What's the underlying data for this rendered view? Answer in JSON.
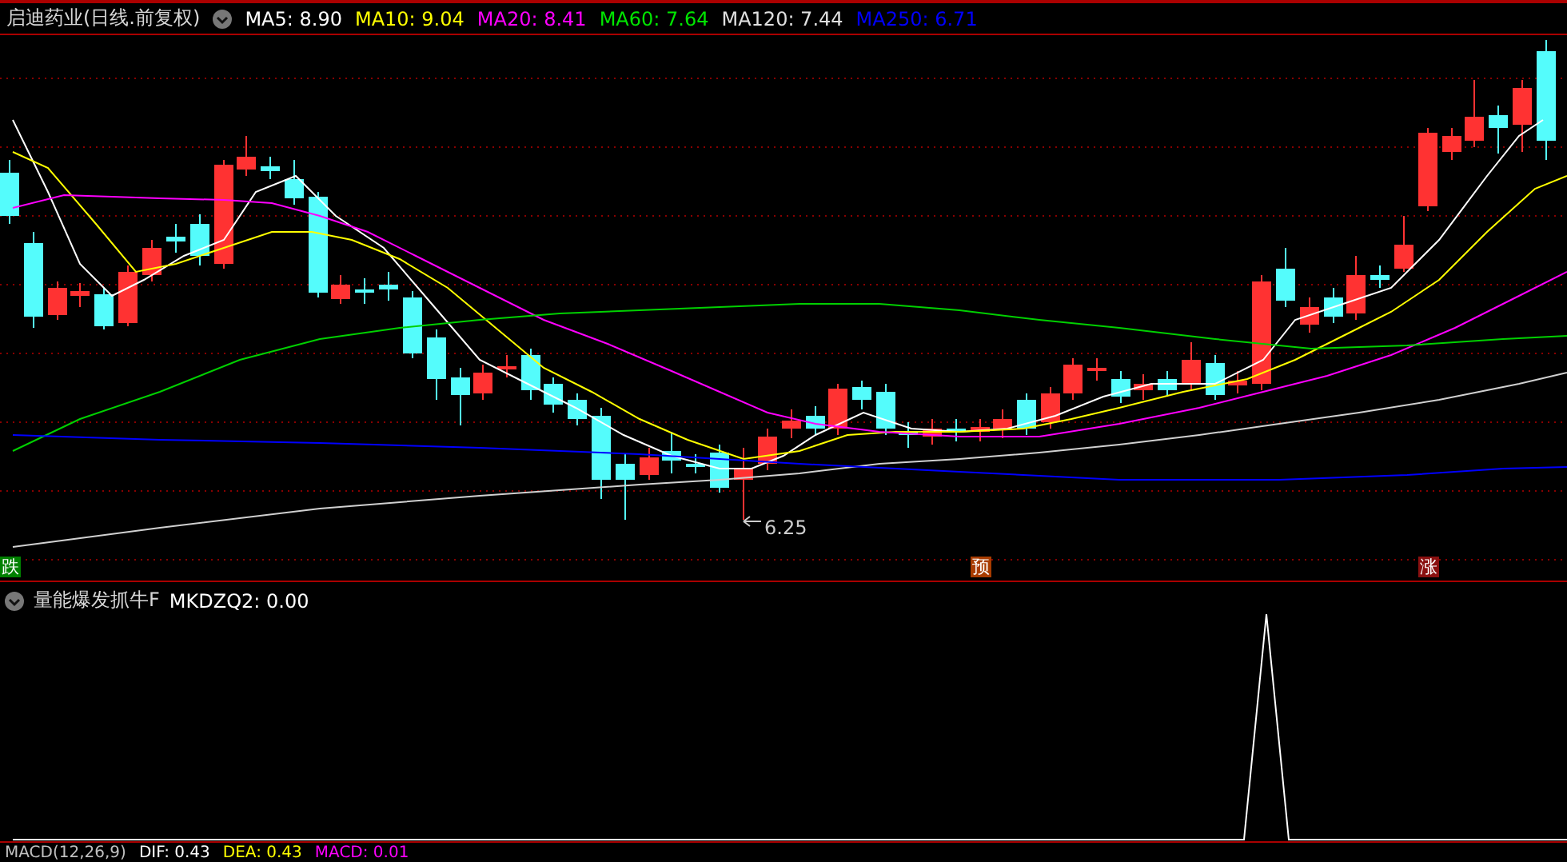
{
  "header": {
    "title": "启迪药业(日线.前复权)",
    "indicators": [
      {
        "label": "MA5: 8.90",
        "color": "#ffffff"
      },
      {
        "label": "MA10: 9.04",
        "color": "#ffff00"
      },
      {
        "label": "MA20: 8.41",
        "color": "#ff00ff"
      },
      {
        "label": "MA60: 7.64",
        "color": "#00e600"
      },
      {
        "label": "MA120: 7.44",
        "color": "#e0e0e0"
      },
      {
        "label": "MA250: 6.71",
        "color": "#0000ff"
      }
    ]
  },
  "price_chart": {
    "low_annotation": "6.25",
    "markers": [
      {
        "label": "跌",
        "color": "#008000"
      },
      {
        "label": "预",
        "color": "#a83c00"
      },
      {
        "label": "涨",
        "color": "#8a1010"
      }
    ]
  },
  "indicator_panel": {
    "title": "量能爆发抓牛F",
    "readings": [
      {
        "label": "MKDZQ2: 0.00",
        "color": "#ffffff"
      }
    ]
  },
  "macd_panel": {
    "readings": [
      {
        "label": "MACD(12,26,9)",
        "color": "#c0c0c0"
      },
      {
        "label": "DIF: 0.43",
        "color": "#ffffff"
      },
      {
        "label": "DEA: 0.43",
        "color": "#ffff00"
      },
      {
        "label": "MACD: 0.01",
        "color": "#ff00ff"
      }
    ]
  }
}
